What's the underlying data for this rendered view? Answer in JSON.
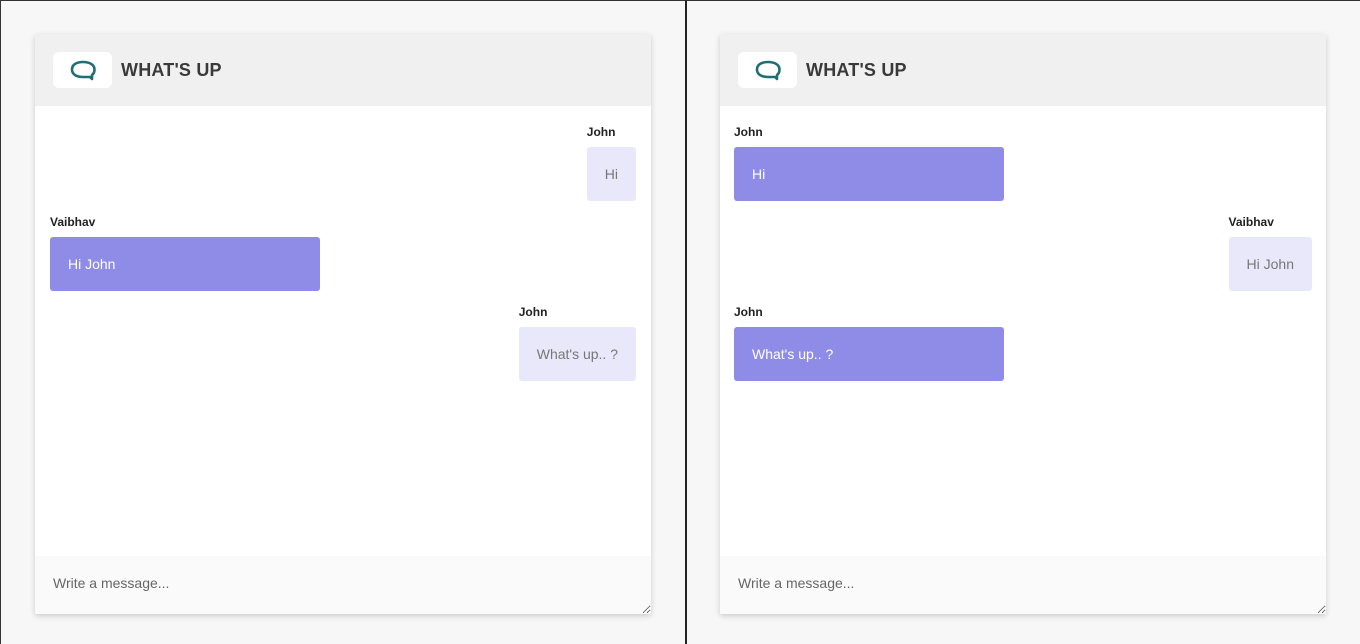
{
  "app": {
    "title": "WHAT'S UP",
    "accent_color": "#8f8ce8",
    "outgoing_color": "#e8e8fa",
    "logo_icon": "chat-bubble-icon"
  },
  "left_pane": {
    "messages": [
      {
        "sender": "John",
        "text": "Hi",
        "side": "outgoing"
      },
      {
        "sender": "Vaibhav",
        "text": "Hi John",
        "side": "incoming"
      },
      {
        "sender": "John",
        "text": "What's up.. ?",
        "side": "outgoing"
      }
    ],
    "composer_placeholder": "Write a message..."
  },
  "right_pane": {
    "messages": [
      {
        "sender": "John",
        "text": "Hi",
        "side": "incoming"
      },
      {
        "sender": "Vaibhav",
        "text": "Hi John",
        "side": "outgoing"
      },
      {
        "sender": "John",
        "text": "What's up.. ?",
        "side": "incoming"
      }
    ],
    "composer_placeholder": "Write a message..."
  }
}
